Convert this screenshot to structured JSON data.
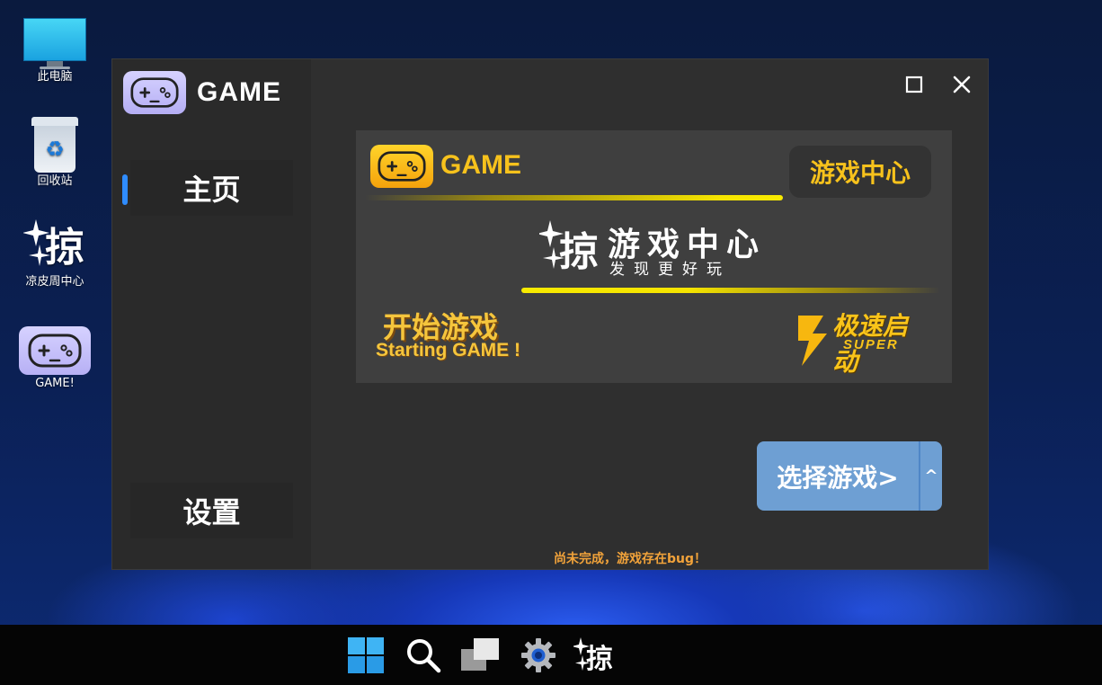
{
  "desktop": {
    "icons": [
      {
        "label": "此电脑"
      },
      {
        "label": "回收站"
      },
      {
        "label": "凉皮周中心"
      },
      {
        "label": "GAME!"
      }
    ]
  },
  "app": {
    "brand": "GAME",
    "nav": {
      "home": "主页",
      "settings": "设置"
    },
    "banner": {
      "brand": "GAME",
      "badge": "游戏中心",
      "logo_char": "掠",
      "title": "游戏中心",
      "subtitle": "发现更好玩",
      "start_cn": "开始游戏",
      "start_en": "Starting GAME !",
      "super_cn": "极速启动",
      "super_en": "SUPER"
    },
    "select_button": {
      "label": "选择游戏>",
      "arrow": "^"
    },
    "footer_note": "尚未完成，游戏存在bug！"
  },
  "taskbar": {
    "items": [
      "windows-start",
      "search",
      "task-view",
      "settings",
      "app"
    ]
  },
  "colors": {
    "accent_blue": "#2f8cff",
    "button_blue": "#6e9fd3",
    "gold": "#f7c21c",
    "warning": "#f2a33a"
  }
}
